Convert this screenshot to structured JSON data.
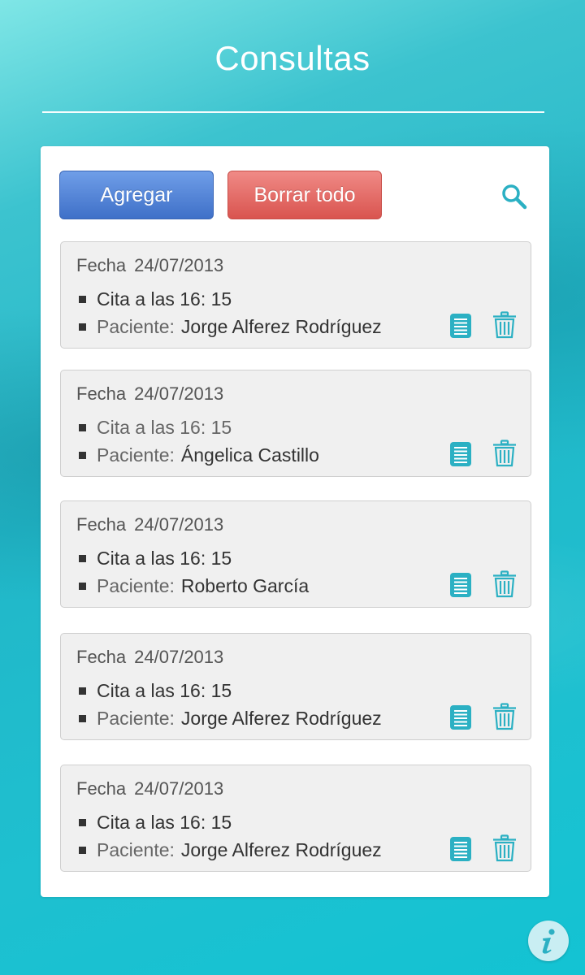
{
  "header": {
    "title": "Consultas"
  },
  "toolbar": {
    "add_label": "Agregar",
    "clear_label": "Borrar todo",
    "search_icon": "search-icon"
  },
  "labels": {
    "date_prefix": "Fecha",
    "patient_prefix": "Paciente:"
  },
  "appointments": [
    {
      "date": "24/07/2013",
      "time_text": "Cita a las 16: 15",
      "patient": "Jorge Alferez Rodríguez"
    },
    {
      "date": "24/07/2013",
      "time_text": "Cita a las 16: 15",
      "patient": "Ángelica Castillo"
    },
    {
      "date": "24/07/2013",
      "time_text": "Cita a las 16: 15",
      "patient": "Roberto García"
    },
    {
      "date": "24/07/2013",
      "time_text": "Cita a las 16: 15",
      "patient": "Jorge Alferez Rodríguez"
    },
    {
      "date": "24/07/2013",
      "time_text": "Cita a las 16: 15",
      "patient": "Jorge Alferez Rodríguez"
    }
  ],
  "colors": {
    "accent": "#2bb0c3",
    "add_button": "#4f80d6",
    "clear_button": "#e36a66"
  }
}
